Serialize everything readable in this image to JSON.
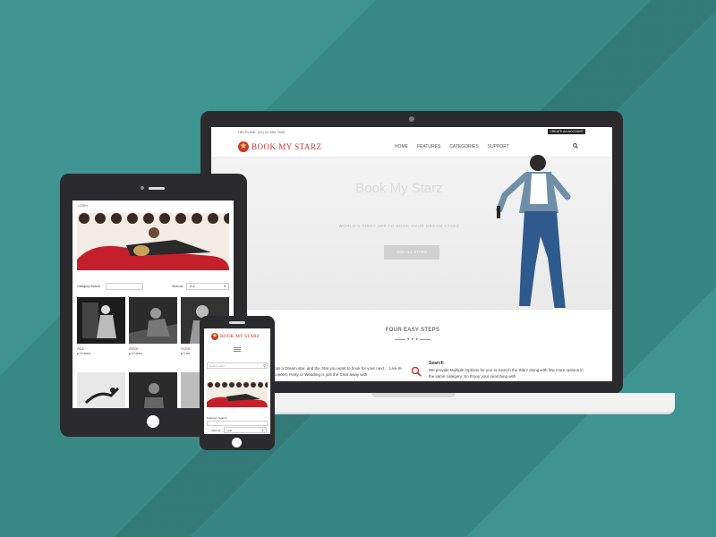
{
  "laptop": {
    "helpline": "HELPLINE: (91) 22 654 7890",
    "create_account": "CREATE AN ACCOUNT",
    "logo_text": "BOOK MY STARZ",
    "menu": [
      "HOME",
      "FEATURES",
      "CATEGORIES",
      "SUPPORT"
    ],
    "hero_title": "Book My Starz",
    "hero_subtitle": "WORLD'S FIRST APP TO BOOK YOUR DREAM STARZ",
    "hero_button": "SEE ALL STARZ",
    "steps_title": "FOUR EASY STEPS",
    "steps_divider": "★ ★ ★",
    "col1_text": "has a Dream star, and the Star you want to book for your next ... Live In-concert, Party or Wedding is just the Click away with",
    "col2_title": "Search",
    "col2_text": "We provide Multiple Options for you to Search the Starz along with few more options in the same category. So   Enjoy your searching with"
  },
  "tablet": {
    "login": "LOGIN",
    "category_search_label": "Category Search",
    "view_as_label": "View as",
    "view_as_value": "A-Z",
    "cards": [
      {
        "name": "ALL",
        "count": "15 stars"
      },
      {
        "name": "Actor",
        "count": "10 stars"
      },
      {
        "name": "Actre",
        "count": "3 sta"
      }
    ]
  },
  "phone": {
    "logo_text": "BOOK MY STARZ",
    "search_placeholder": "Search starz",
    "category_search_label": "Category Search",
    "view_as_label": "View as",
    "view_as_value": "A-Z"
  },
  "colors": {
    "background": "#3d9491",
    "brand_red": "#c9362a",
    "device_dark": "#2b2b2e"
  }
}
